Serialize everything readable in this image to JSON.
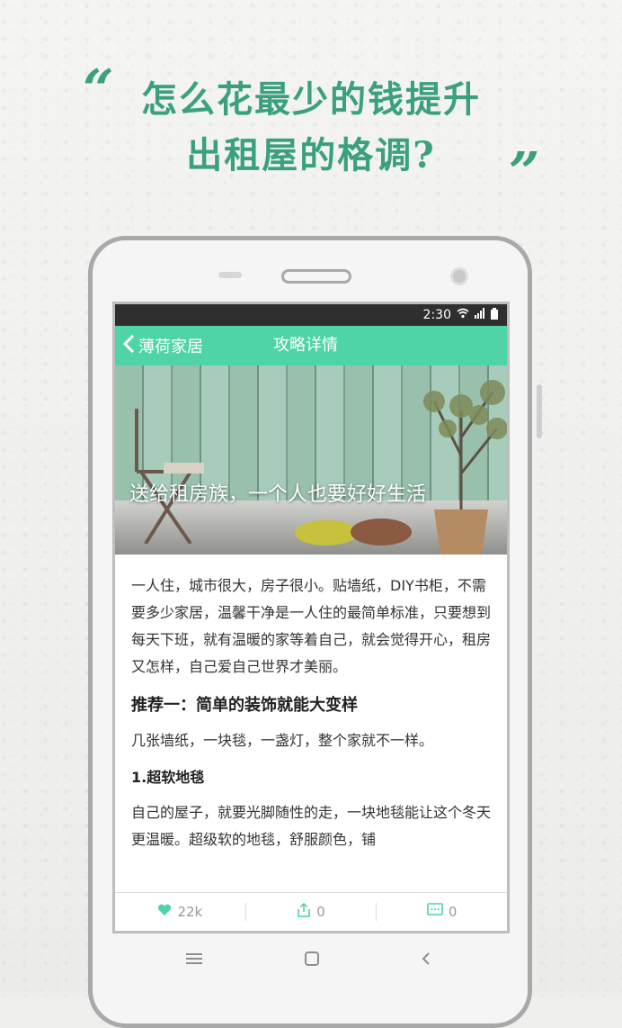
{
  "promo": {
    "line1": "怎么花最少的钱提升",
    "line2": "出租屋的格调?",
    "open_quote": "“",
    "close_quote": "”"
  },
  "status_bar": {
    "time": "2:30"
  },
  "nav": {
    "back_label": "薄荷家居",
    "title": "攻略详情"
  },
  "hero": {
    "title": "送给租房族，一个人也要好好生活"
  },
  "article": {
    "intro": "一人住，城市很大，房子很小。贴墙纸，DIY书柜，不需要多少家居，温馨干净是一人住的最简单标准，只要想到每天下班，就有温暖的家等着自己，就会觉得开心，租房又怎样，自己爱自己世界才美丽。",
    "section1_title": "推荐一：简单的装饰就能大变样",
    "section1_text": "几张墙纸，一块毯，一盏灯，整个家就不一样。",
    "item1_title": "1.超软地毯",
    "item1_text": "自己的屋子，就要光脚随性的走，一块地毯能让这个冬天更温暖。超级软的地毯，舒服颜色，铺"
  },
  "bottom_bar": {
    "likes": "22k",
    "shares": "0",
    "comments": "0"
  },
  "colors": {
    "accent": "#4fd4a8",
    "headline": "#3aa07e"
  }
}
